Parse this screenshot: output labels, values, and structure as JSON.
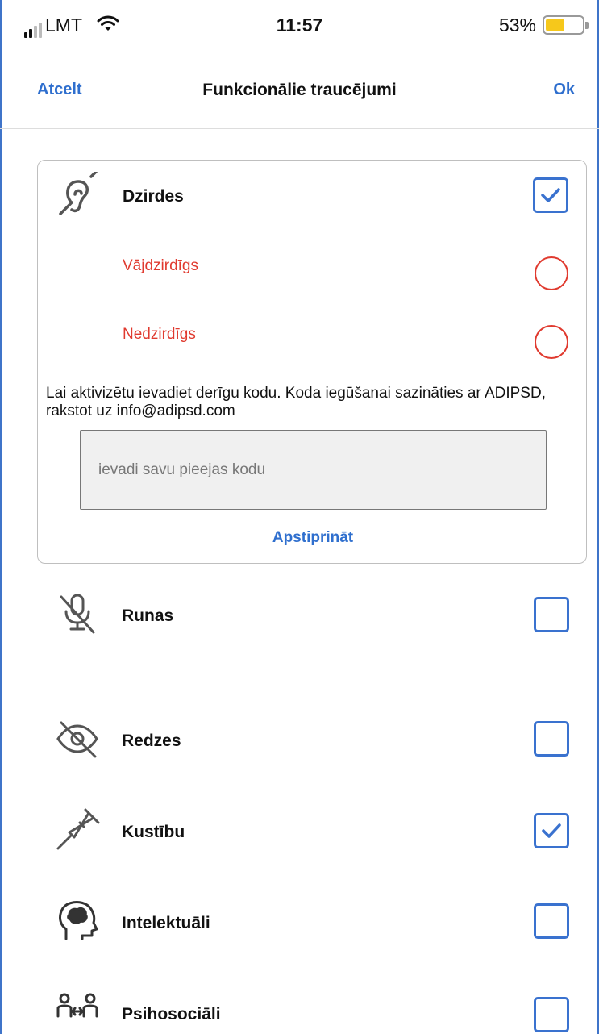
{
  "status_bar": {
    "carrier": "LMT",
    "time": "11:57",
    "battery_percent": "53%",
    "battery_level": 0.53,
    "battery_color": "#f6c81b"
  },
  "nav": {
    "cancel_label": "Atcelt",
    "title": "Funkcionālie traucējumi",
    "ok_label": "Ok"
  },
  "categories": {
    "hearing": {
      "label": "Dzirdes",
      "icon": "hearing-disabled-icon",
      "checked": true,
      "options": [
        "Vājdzirdīgs",
        "Nedzirdīgs"
      ],
      "info_text": "Lai aktivizētu ievadiet derīgu kodu. Koda iegūšanai sazināties ar ADIPSD, rakstot uz info@adipsd.com",
      "code_placeholder": "ievadi savu pieejas kodu",
      "confirm_label": "Apstiprināt"
    },
    "speech": {
      "label": "Runas",
      "icon": "mic-off-icon",
      "checked": false
    },
    "vision": {
      "label": "Redzes",
      "icon": "eye-off-icon",
      "checked": false
    },
    "mobility": {
      "label": "Kustību",
      "icon": "crutch-icon",
      "checked": true
    },
    "intellectual": {
      "label": "Intelektuāli",
      "icon": "head-brain-icon",
      "checked": false
    },
    "psychosocial": {
      "label": "Psihosociāli",
      "icon": "people-exchange-icon",
      "checked": false
    }
  },
  "colors": {
    "accent": "#2f6fce",
    "checkbox": "#3a72cf",
    "option_red": "#e03a2f"
  }
}
